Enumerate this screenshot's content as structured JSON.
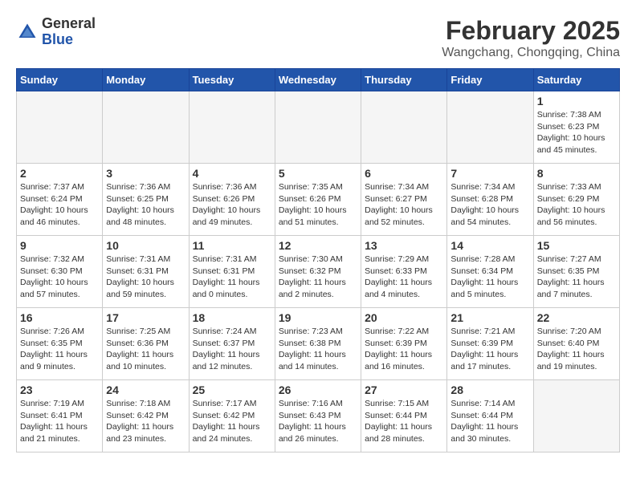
{
  "logo": {
    "general": "General",
    "blue": "Blue"
  },
  "title": "February 2025",
  "subtitle": "Wangchang, Chongqing, China",
  "days_header": [
    "Sunday",
    "Monday",
    "Tuesday",
    "Wednesday",
    "Thursday",
    "Friday",
    "Saturday"
  ],
  "weeks": [
    [
      {
        "day": "",
        "info": ""
      },
      {
        "day": "",
        "info": ""
      },
      {
        "day": "",
        "info": ""
      },
      {
        "day": "",
        "info": ""
      },
      {
        "day": "",
        "info": ""
      },
      {
        "day": "",
        "info": ""
      },
      {
        "day": "1",
        "info": "Sunrise: 7:38 AM\nSunset: 6:23 PM\nDaylight: 10 hours and 45 minutes."
      }
    ],
    [
      {
        "day": "2",
        "info": "Sunrise: 7:37 AM\nSunset: 6:24 PM\nDaylight: 10 hours and 46 minutes."
      },
      {
        "day": "3",
        "info": "Sunrise: 7:36 AM\nSunset: 6:25 PM\nDaylight: 10 hours and 48 minutes."
      },
      {
        "day": "4",
        "info": "Sunrise: 7:36 AM\nSunset: 6:26 PM\nDaylight: 10 hours and 49 minutes."
      },
      {
        "day": "5",
        "info": "Sunrise: 7:35 AM\nSunset: 6:26 PM\nDaylight: 10 hours and 51 minutes."
      },
      {
        "day": "6",
        "info": "Sunrise: 7:34 AM\nSunset: 6:27 PM\nDaylight: 10 hours and 52 minutes."
      },
      {
        "day": "7",
        "info": "Sunrise: 7:34 AM\nSunset: 6:28 PM\nDaylight: 10 hours and 54 minutes."
      },
      {
        "day": "8",
        "info": "Sunrise: 7:33 AM\nSunset: 6:29 PM\nDaylight: 10 hours and 56 minutes."
      }
    ],
    [
      {
        "day": "9",
        "info": "Sunrise: 7:32 AM\nSunset: 6:30 PM\nDaylight: 10 hours and 57 minutes."
      },
      {
        "day": "10",
        "info": "Sunrise: 7:31 AM\nSunset: 6:31 PM\nDaylight: 10 hours and 59 minutes."
      },
      {
        "day": "11",
        "info": "Sunrise: 7:31 AM\nSunset: 6:31 PM\nDaylight: 11 hours and 0 minutes."
      },
      {
        "day": "12",
        "info": "Sunrise: 7:30 AM\nSunset: 6:32 PM\nDaylight: 11 hours and 2 minutes."
      },
      {
        "day": "13",
        "info": "Sunrise: 7:29 AM\nSunset: 6:33 PM\nDaylight: 11 hours and 4 minutes."
      },
      {
        "day": "14",
        "info": "Sunrise: 7:28 AM\nSunset: 6:34 PM\nDaylight: 11 hours and 5 minutes."
      },
      {
        "day": "15",
        "info": "Sunrise: 7:27 AM\nSunset: 6:35 PM\nDaylight: 11 hours and 7 minutes."
      }
    ],
    [
      {
        "day": "16",
        "info": "Sunrise: 7:26 AM\nSunset: 6:35 PM\nDaylight: 11 hours and 9 minutes."
      },
      {
        "day": "17",
        "info": "Sunrise: 7:25 AM\nSunset: 6:36 PM\nDaylight: 11 hours and 10 minutes."
      },
      {
        "day": "18",
        "info": "Sunrise: 7:24 AM\nSunset: 6:37 PM\nDaylight: 11 hours and 12 minutes."
      },
      {
        "day": "19",
        "info": "Sunrise: 7:23 AM\nSunset: 6:38 PM\nDaylight: 11 hours and 14 minutes."
      },
      {
        "day": "20",
        "info": "Sunrise: 7:22 AM\nSunset: 6:39 PM\nDaylight: 11 hours and 16 minutes."
      },
      {
        "day": "21",
        "info": "Sunrise: 7:21 AM\nSunset: 6:39 PM\nDaylight: 11 hours and 17 minutes."
      },
      {
        "day": "22",
        "info": "Sunrise: 7:20 AM\nSunset: 6:40 PM\nDaylight: 11 hours and 19 minutes."
      }
    ],
    [
      {
        "day": "23",
        "info": "Sunrise: 7:19 AM\nSunset: 6:41 PM\nDaylight: 11 hours and 21 minutes."
      },
      {
        "day": "24",
        "info": "Sunrise: 7:18 AM\nSunset: 6:42 PM\nDaylight: 11 hours and 23 minutes."
      },
      {
        "day": "25",
        "info": "Sunrise: 7:17 AM\nSunset: 6:42 PM\nDaylight: 11 hours and 24 minutes."
      },
      {
        "day": "26",
        "info": "Sunrise: 7:16 AM\nSunset: 6:43 PM\nDaylight: 11 hours and 26 minutes."
      },
      {
        "day": "27",
        "info": "Sunrise: 7:15 AM\nSunset: 6:44 PM\nDaylight: 11 hours and 28 minutes."
      },
      {
        "day": "28",
        "info": "Sunrise: 7:14 AM\nSunset: 6:44 PM\nDaylight: 11 hours and 30 minutes."
      },
      {
        "day": "",
        "info": ""
      }
    ]
  ]
}
